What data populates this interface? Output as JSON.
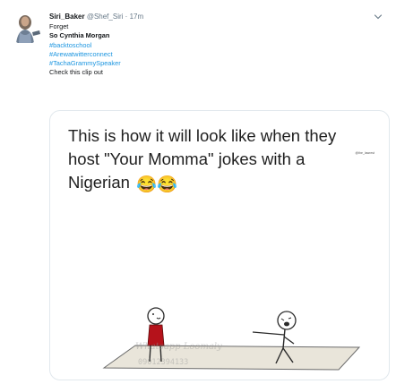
{
  "tweet": {
    "author_name": "Siri_Baker",
    "author_handle": "@Shef_Siri",
    "separator": "·",
    "time": "17m",
    "lines": {
      "l1": "Forget",
      "l2": "So Cynthia Morgan",
      "l3": "#backtoschool",
      "l4": "#Arewatwitterconnect",
      "l5": "#TachaGrammySpeaker",
      "l6": "Check this clip out"
    }
  },
  "media": {
    "caption_lines": [
      "This is how it will look like when they",
      "host \"Your Momma\" jokes with a",
      "Nigerian"
    ],
    "caption_emoji": "😂😂",
    "small_credit": "@the_lawrest",
    "watermark_line1": "Whatsapp  Loomaly",
    "watermark_line2": "09012394133"
  },
  "icons": {
    "caret": "chevron-down-icon",
    "emoji": "tears-of-joy-emoji"
  },
  "colors": {
    "link": "#1b95e0",
    "muted": "#657786",
    "dress": "#b5121b",
    "mat": "#e9e5da"
  }
}
